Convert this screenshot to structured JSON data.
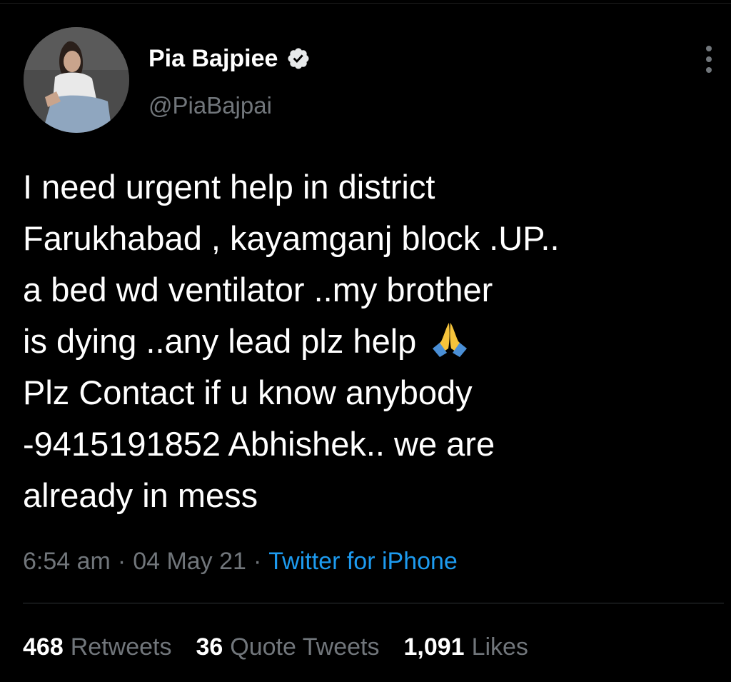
{
  "user": {
    "display_name": "Pia Bajpiee",
    "handle": "@PiaBajpai",
    "avatar_icon": "profile-photo",
    "verified_icon": "verified-badge-icon"
  },
  "tweet": {
    "lines": [
      "I need urgent help in district",
      "Farukhabad , kayamganj block .UP..",
      "a bed wd ventilator ..my brother",
      "is dying ..any lead plz help",
      "Plz Contact if u know anybody",
      "-9415191852 Abhishek.. we are",
      "already in mess"
    ],
    "emoji": "folded-hands-icon"
  },
  "meta": {
    "time": "6:54 am",
    "separator": "·",
    "date": "04 May 21",
    "source": "Twitter for iPhone"
  },
  "stats": {
    "retweets_count": "468",
    "retweets_label": "Retweets",
    "quotes_count": "36",
    "quotes_label": "Quote Tweets",
    "likes_count": "1,091",
    "likes_label": "Likes"
  },
  "colors": {
    "background": "#000000",
    "primary_text": "#ffffff",
    "secondary_text": "#71767b",
    "link": "#1d9bf0",
    "divider": "#2f3336"
  }
}
